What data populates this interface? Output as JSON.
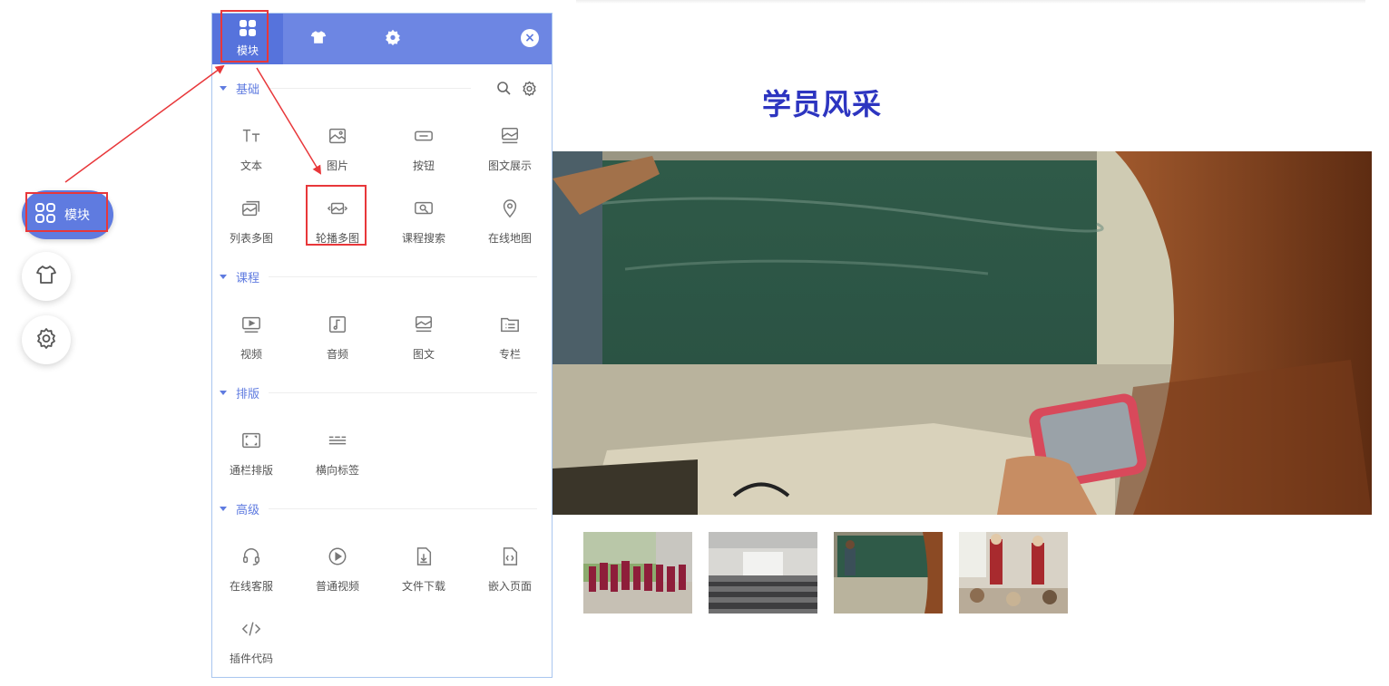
{
  "panel": {
    "tabs": [
      {
        "label": "模块",
        "icon": "grid-icon"
      },
      {
        "label": "",
        "icon": "tshirt-icon"
      },
      {
        "label": "",
        "icon": "gear-icon"
      }
    ],
    "sections": [
      {
        "title": "基础",
        "items": [
          "文本",
          "图片",
          "按钮",
          "图文展示",
          "列表多图",
          "轮播多图",
          "课程搜索",
          "在线地图"
        ]
      },
      {
        "title": "课程",
        "items": [
          "视频",
          "音频",
          "图文",
          "专栏"
        ]
      },
      {
        "title": "排版",
        "items": [
          "通栏排版",
          "横向标签"
        ]
      },
      {
        "title": "高级",
        "items": [
          "在线客服",
          "普通视频",
          "文件下载",
          "嵌入页面",
          "插件代码"
        ]
      }
    ]
  },
  "sidebar": {
    "module_label": "模块"
  },
  "content": {
    "title": "学员风采"
  },
  "colors": {
    "accent": "#6d86e3",
    "title": "#2d35c0",
    "highlight": "#e8373a"
  }
}
